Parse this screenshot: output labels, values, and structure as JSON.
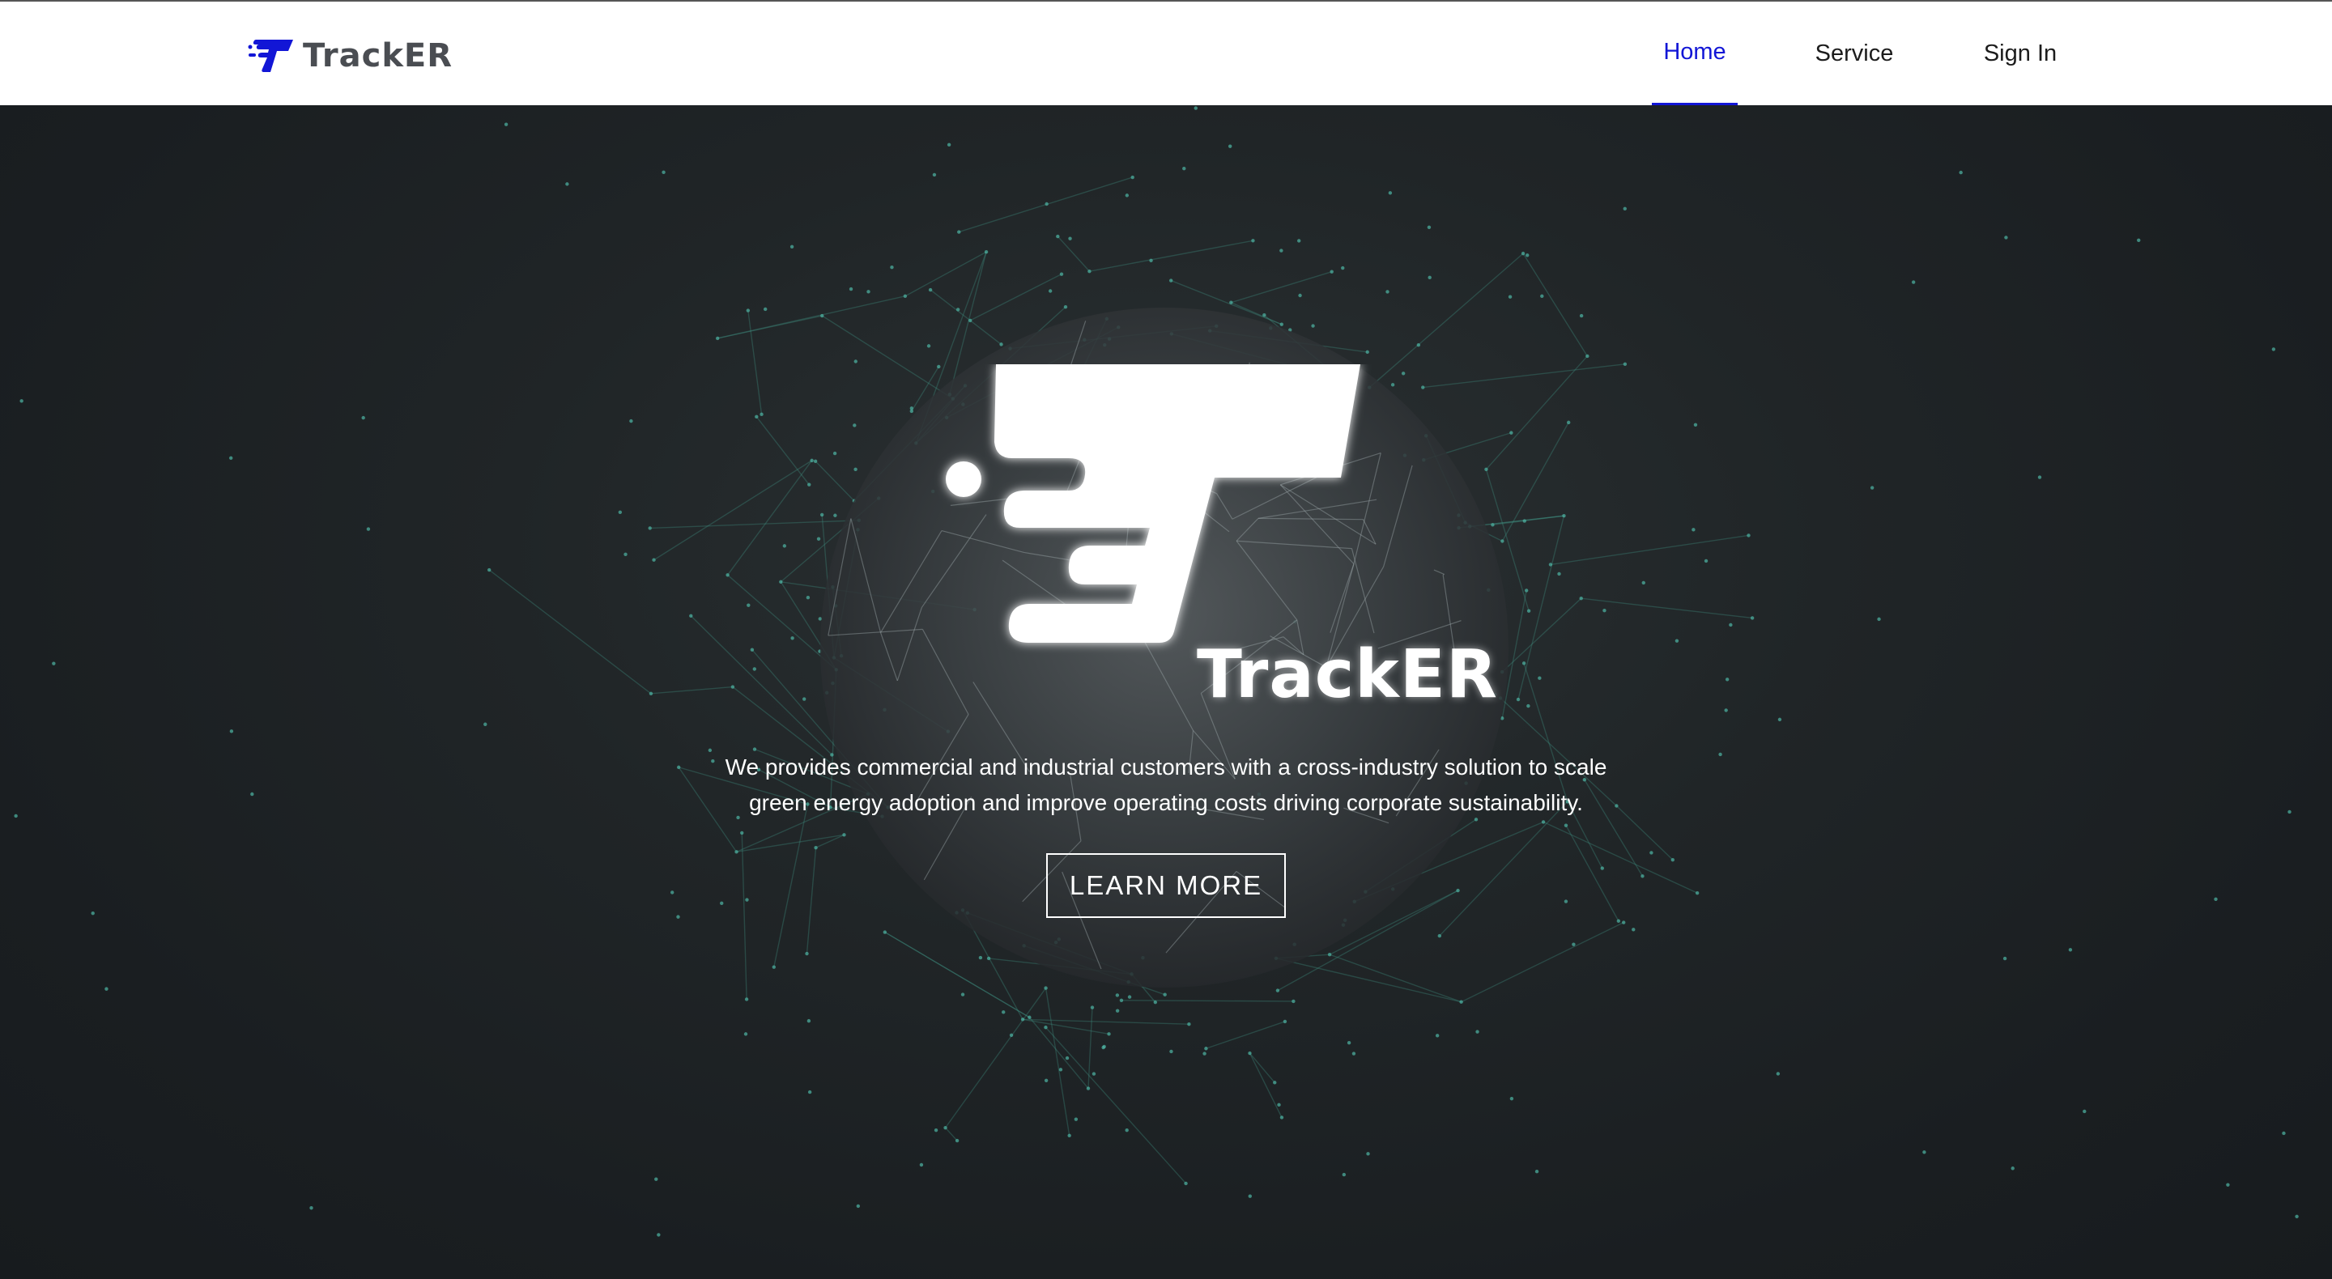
{
  "brand": {
    "name": "TrackER",
    "accent_color": "#1216d6",
    "icon": "tracker-logo-icon"
  },
  "nav": {
    "items": [
      {
        "label": "Home",
        "active": true
      },
      {
        "label": "Service",
        "active": false
      },
      {
        "label": "Sign In",
        "active": false
      }
    ]
  },
  "hero": {
    "logo_text": "TrackER",
    "description": "We provides commercial and industrial customers with a cross-industry solution to scale green energy adoption and improve operating costs driving corporate sustainability.",
    "cta_label": "LEARN MORE",
    "background": "network-sphere-image"
  }
}
